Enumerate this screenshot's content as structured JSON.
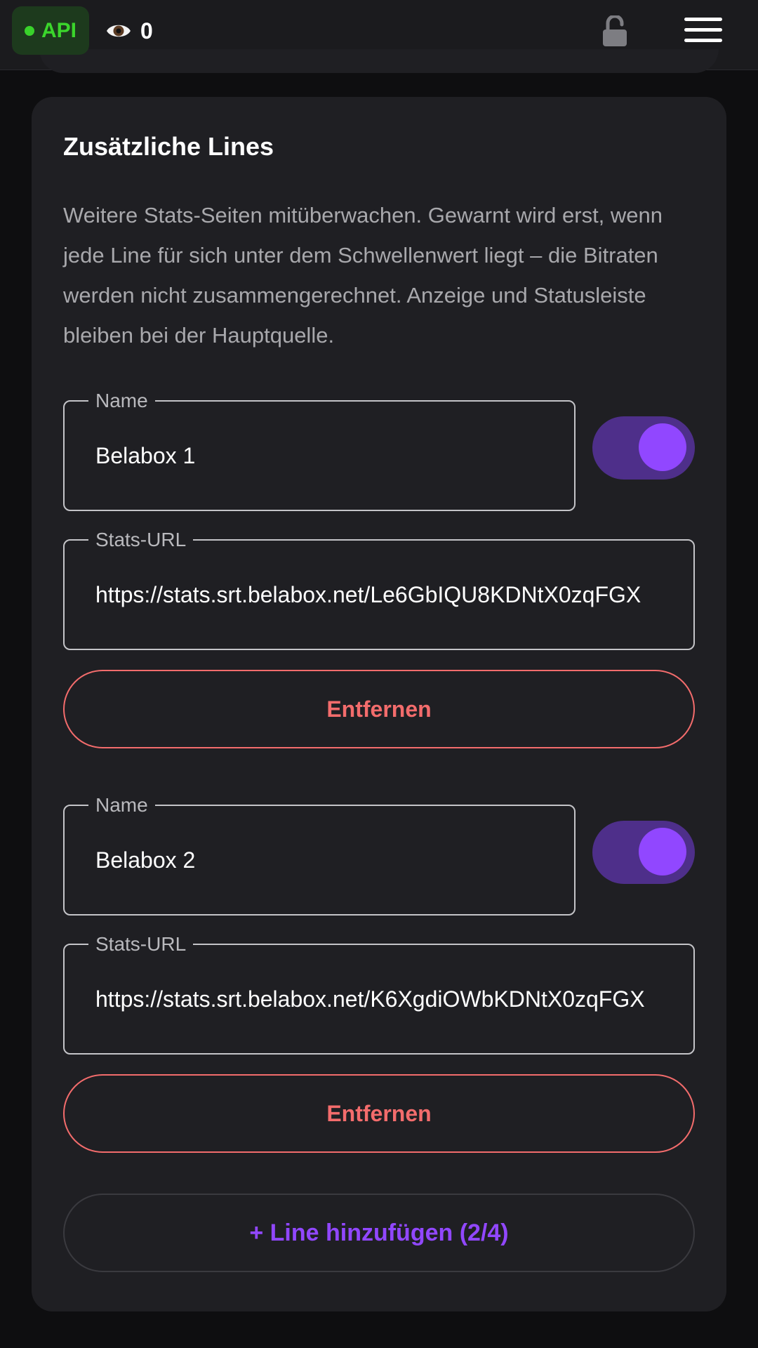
{
  "header": {
    "api_label": "API",
    "viewer_count": "0",
    "api_status_color": "#39d22b"
  },
  "section": {
    "title": "Zusätzliche Lines",
    "description": "Weitere Stats-Seiten mitüberwachen. Gewarnt wird erst, wenn jede Line für sich unter dem Schwellenwert liegt – die Bitraten werden nicht zusammengerechnet. Anzeige und Statusleiste bleiben bei der Hauptquelle."
  },
  "lines": [
    {
      "name_label": "Name",
      "name_value": "Belabox 1",
      "enabled": true,
      "url_label": "Stats-URL",
      "url_value": "https://stats.srt.belabox.net/Le6GbIQU8KDNtX0zqFGX",
      "remove_label": "Entfernen"
    },
    {
      "name_label": "Name",
      "name_value": "Belabox 2",
      "enabled": true,
      "url_label": "Stats-URL",
      "url_value": "https://stats.srt.belabox.net/K6XgdiOWbKDNtX0zqFGX",
      "remove_label": "Entfernen"
    }
  ],
  "add_line_label": "+ Line hinzufügen (2/4)",
  "colors": {
    "accent": "#9147ff",
    "danger": "#f36c6c",
    "toggle_track": "#4e2f8a"
  }
}
